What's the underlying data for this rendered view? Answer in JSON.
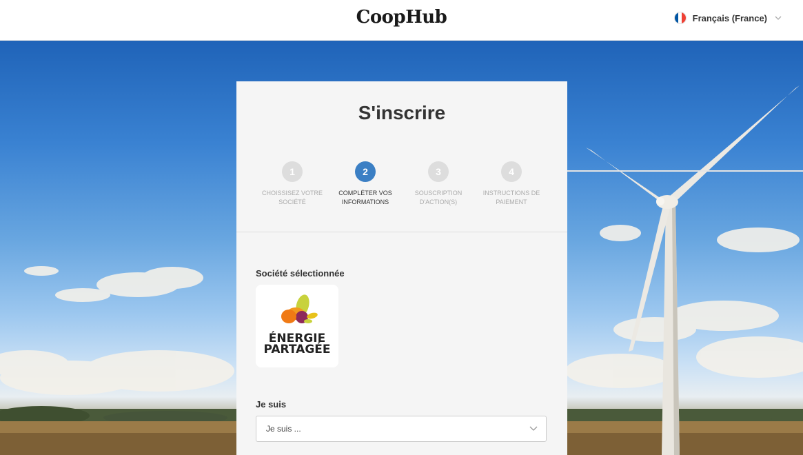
{
  "header": {
    "brand": "CoopHub",
    "language": "Français (France)",
    "flag_colors": [
      "#0055A4",
      "#FFFFFF",
      "#EF4135"
    ]
  },
  "card": {
    "title": "S'inscrire",
    "steps": [
      {
        "number": "1",
        "label": "CHOISSISEZ VOTRE SOCIÉTÉ",
        "active": false
      },
      {
        "number": "2",
        "label": "COMPLÉTER VOS INFORMATIONS",
        "active": true
      },
      {
        "number": "3",
        "label": "SOUSCRIPTION D'ACTION(S)",
        "active": false
      },
      {
        "number": "4",
        "label": "INSTRUCTIONS DE PAIEMENT",
        "active": false
      }
    ],
    "selected_company_label": "Société sélectionnée",
    "company_logo_text": "ÉNERGIE PARTAGÉE",
    "je_suis_label": "Je suis",
    "je_suis_select": "Je suis ..."
  },
  "colors": {
    "accent": "#3b7fc4",
    "inactive_step": "#dddddd"
  }
}
